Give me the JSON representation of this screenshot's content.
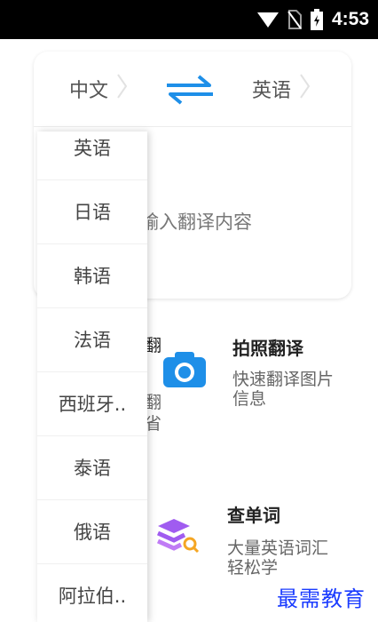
{
  "status_bar": {
    "time": "4:53",
    "icons": [
      "wifi-icon",
      "no-sim-icon",
      "battery-charging-icon"
    ]
  },
  "language_bar": {
    "source": "中文",
    "target": "英语",
    "swap_icon": "swap-arrows-icon"
  },
  "input": {
    "placeholder": "输入翻译内容"
  },
  "features": [
    {
      "title": "拍照翻译",
      "desc_line1": "快速翻译图片",
      "desc_line2": "信息",
      "icon": "camera-icon",
      "color": "#1e8fe8"
    },
    {
      "title": "查单词",
      "desc_line1": "大量英语词汇",
      "desc_line2": "轻松学",
      "icon": "book-search-icon",
      "color": "#a05cf0"
    }
  ],
  "partial_text": {
    "a": "翻",
    "b": "翻",
    "c": "省"
  },
  "dropdown": {
    "items": [
      "英语",
      "日语",
      "韩语",
      "法语",
      "西班牙..",
      "泰语",
      "俄语",
      "阿拉伯.."
    ]
  },
  "watermark": "最需教育",
  "colors": {
    "accent": "#1e8fe8",
    "purple": "#a05cf0",
    "orange": "#f5a623"
  }
}
